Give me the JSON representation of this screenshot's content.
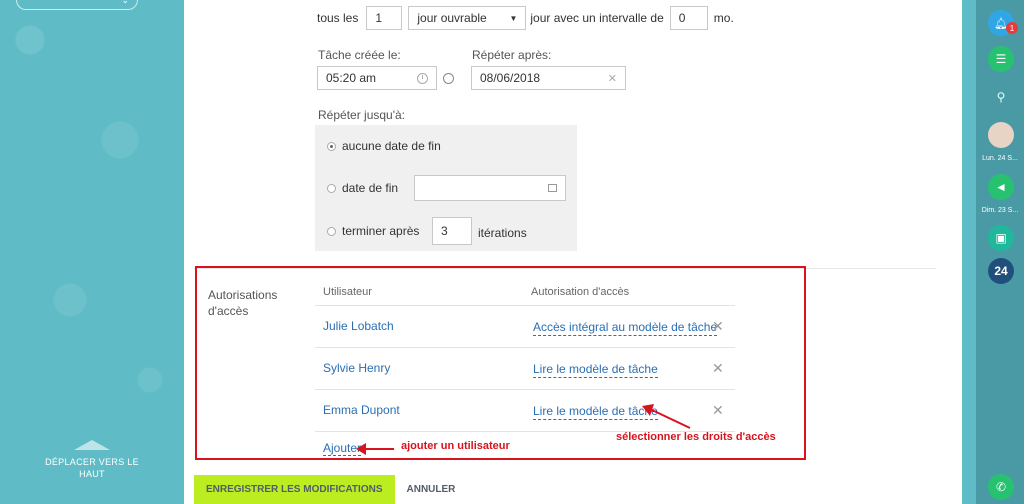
{
  "top_pill": {
    "caret": "⌄"
  },
  "left_panel": {
    "move_up_label": "DÉPLACER VERS LE HAUT"
  },
  "recurrence": {
    "every_label": "tous les",
    "every_value": "1",
    "unit_value": "jour ouvrable",
    "interval_label": "jour avec un intervalle de",
    "interval_value": "0",
    "interval_unit": "mo."
  },
  "task_created": {
    "label": "Tâche créée le:",
    "value": "05:20 am"
  },
  "repeat_after": {
    "label": "Répéter après:",
    "value": "08/06/2018"
  },
  "repeat_until": {
    "label": "Répéter jusqu'à:",
    "options": {
      "no_end": "aucune date de fin",
      "end_date": "date de fin",
      "end_after": "terminer après",
      "iterations_value": "3",
      "iterations_label": "itérations"
    }
  },
  "permissions": {
    "section_label": "Autorisations d'accès",
    "col_user": "Utilisateur",
    "col_access": "Autorisation d'accès",
    "rows": [
      {
        "user": "Julie Lobatch",
        "access": "Accès intégral au modèle de tâche"
      },
      {
        "user": "Sylvie Henry",
        "access": "Lire le modèle de tâche"
      },
      {
        "user": "Emma Dupont",
        "access": "Lire le modèle de tâche"
      }
    ],
    "add_label": "Ajouter"
  },
  "annotations": {
    "add_user": "ajouter un utilisateur",
    "select_rights": "sélectionner les droits d'accès"
  },
  "buttons": {
    "save": "ENREGISTRER LES MODIFICATIONS",
    "cancel": "ANNULER"
  },
  "right_bar": {
    "notification_count": "1",
    "date1": "Lun. 24 S...",
    "date2": "Dim. 23 S...",
    "logo_text": "24"
  },
  "colors": {
    "accent_green": "#bbed21",
    "link_blue": "#2a6fb3",
    "annotation_red": "#d7141e",
    "teal": "#5fbcc6"
  }
}
